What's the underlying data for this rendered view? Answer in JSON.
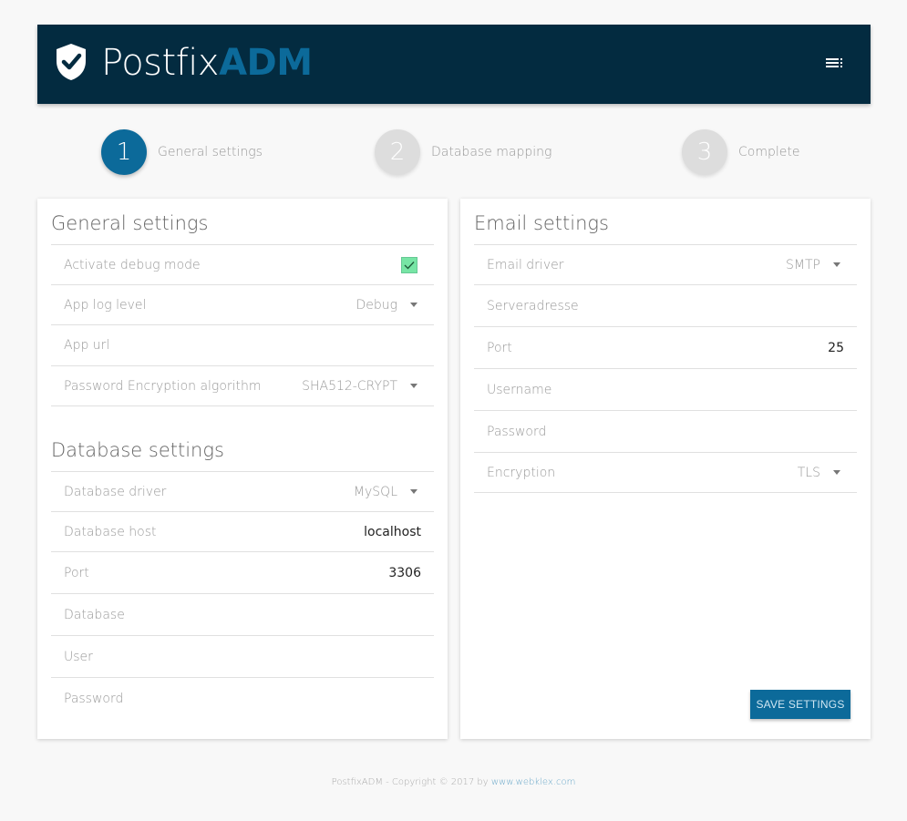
{
  "header": {
    "brand_part1": "Postfix",
    "brand_part2": "ADM",
    "menu_icon": "menu-icon",
    "logo_icon": "shield-check-icon"
  },
  "stepper": [
    {
      "number": "1",
      "label": "General settings",
      "state": "active"
    },
    {
      "number": "2",
      "label": "Database mapping",
      "state": "inactive"
    },
    {
      "number": "3",
      "label": "Complete",
      "state": "inactive"
    }
  ],
  "general": {
    "title": "General settings",
    "debug_label": "Activate debug mode",
    "debug_checked": true,
    "log_level_label": "App log level",
    "log_level_value": "Debug",
    "app_url_label": "App url",
    "encryption_label": "Password Encryption algorithm",
    "encryption_value": "SHA512-CRYPT"
  },
  "database": {
    "title": "Database settings",
    "driver_label": "Database driver",
    "driver_value": "MySQL",
    "host_label": "Database host",
    "host_value": "localhost",
    "port_label": "Port",
    "port_value": "3306",
    "database_label": "Database",
    "user_label": "User",
    "password_label": "Password"
  },
  "email": {
    "title": "Email settings",
    "driver_label": "Email driver",
    "driver_value": "SMTP",
    "server_label": "Serveradresse",
    "port_label": "Port",
    "port_value": "25",
    "username_label": "Username",
    "password_label": "Password",
    "encryption_label": "Encryption",
    "encryption_value": "TLS"
  },
  "actions": {
    "save_label": "Save settings"
  },
  "footer": {
    "text": "PostfixADM - Copyright © 2017 by ",
    "link": "www.webklex.com"
  },
  "colors": {
    "header_bg": "#032b40",
    "accent": "#0c6a9a",
    "checkbox": "#77e5a5"
  }
}
